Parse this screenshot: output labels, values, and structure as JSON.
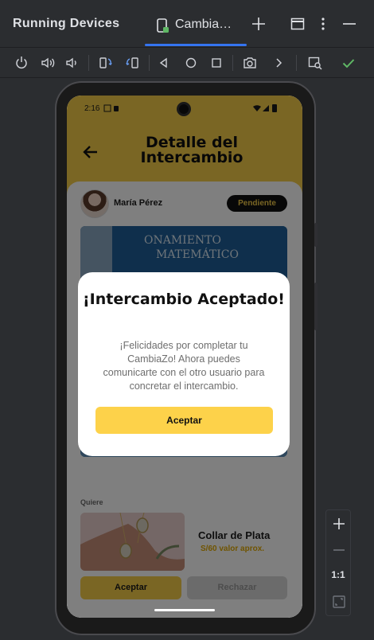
{
  "ide": {
    "panel_title": "Running Devices",
    "device_tab_label": "Cambia…"
  },
  "app": {
    "status_time": "2:16",
    "screen_title": "Detalle del Intercambio",
    "user_name": "María Pérez",
    "status_badge": "Pendiente",
    "wants_label": "Quiere",
    "item_name": "Collar de Plata",
    "item_value": "S/60 valor aprox.",
    "accept_label": "Aceptar",
    "reject_label": "Rechazar"
  },
  "dialog": {
    "title": "¡Intercambio Aceptado!",
    "message": "¡Felicidades por completar tu CambiaZo! Ahora puedes comunicarte con el otro usuario para concretar el intercambio.",
    "button_label": "Aceptar"
  },
  "zoom": {
    "one_to_one": "1:1"
  },
  "book": {
    "cover_text_1": "ONAMIENTO",
    "cover_text_2": "MATEMÁTICO"
  },
  "colors": {
    "accent_yellow": "#f5cc48",
    "badge_bg": "#111111",
    "ide_bg": "#2b2d30",
    "ide_tab_underline": "#3574f0",
    "check_green": "#5fb865"
  }
}
